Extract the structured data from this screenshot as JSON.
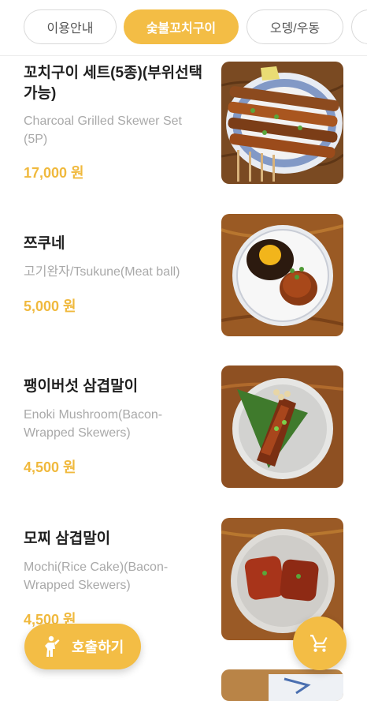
{
  "tabs": [
    {
      "label": "이용안내",
      "active": false
    },
    {
      "label": "숯불꼬치구이",
      "active": true
    },
    {
      "label": "오뎅/우동",
      "active": false
    },
    {
      "label": "",
      "active": false
    }
  ],
  "menu_items": [
    {
      "name": "꼬치구이 세트(5종)(부위선택 가능)",
      "description": "Charcoal Grilled Skewer Set (5P)",
      "price": "17,000 원",
      "image_icon": "skewer-set-photo"
    },
    {
      "name": "쯔쿠네",
      "description": "고기완자/Tsukune(Meat ball)",
      "price": "5,000 원",
      "image_icon": "tsukune-photo"
    },
    {
      "name": "팽이버섯 삼겹말이",
      "description": "Enoki Mushroom(Bacon-Wrapped Skewers)",
      "price": "4,500 원",
      "image_icon": "enoki-bacon-photo"
    },
    {
      "name": "모찌 삼겹말이",
      "description": "Mochi(Rice Cake)(Bacon-Wrapped Skewers)",
      "price": "4,500 원",
      "image_icon": "mochi-bacon-photo"
    }
  ],
  "call_button": {
    "label": "호출하기",
    "icon": "person-icon"
  },
  "cart_button": {
    "icon": "cart-icon"
  },
  "colors": {
    "accent": "#f3bd45",
    "price": "#f0b93d",
    "muted_text": "#a9a9a9"
  }
}
